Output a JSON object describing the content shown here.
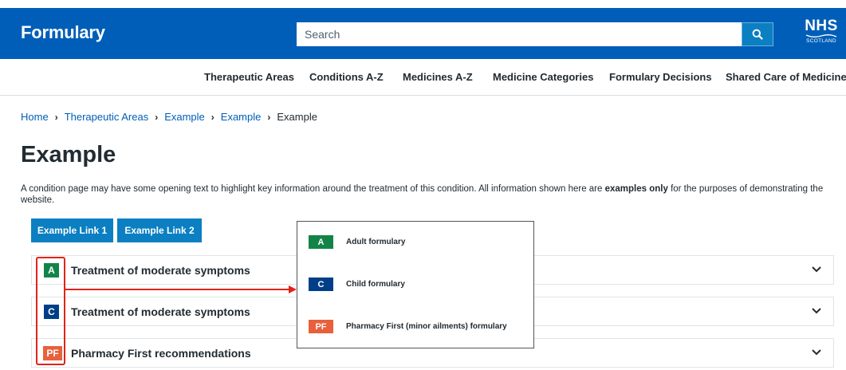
{
  "header": {
    "brand": "Formulary",
    "search_placeholder": "Search",
    "logo": {
      "line1": "NHS",
      "line2": "SCOTLAND"
    }
  },
  "nav": {
    "items": [
      "Therapeutic Areas",
      "Conditions A-Z",
      "Medicines A-Z",
      "Medicine Categories",
      "Formulary Decisions",
      "Shared Care of Medicines"
    ]
  },
  "breadcrumb": {
    "links": [
      "Home",
      "Therapeutic Areas",
      "Example",
      "Example"
    ],
    "current": "Example",
    "separator": "›"
  },
  "page": {
    "title": "Example",
    "intro_part1": "A condition page may have some opening text to highlight key information around the treatment of this condition.  All information shown here are ",
    "intro_bold": "examples only",
    "intro_part2": " for the purposes of demonstrating the website."
  },
  "buttons": [
    "Example Link 1",
    "Example Link 2"
  ],
  "accordion": [
    {
      "badge": "A",
      "badge_color": "#138447",
      "label": "Treatment of moderate symptoms"
    },
    {
      "badge": "C",
      "badge_color": "#003f87",
      "label": "Treatment of moderate symptoms"
    },
    {
      "badge": "PF",
      "badge_color": "#e8603c",
      "label": "Pharmacy First recommendations"
    }
  ],
  "legend": [
    {
      "badge": "A",
      "badge_color": "#138447",
      "text": "Adult formulary"
    },
    {
      "badge": "C",
      "badge_color": "#003f87",
      "text": "Child formulary"
    },
    {
      "badge": "PF",
      "badge_color": "#e8603c",
      "text": "Pharmacy First (minor ailments) formulary"
    }
  ],
  "colors": {
    "header_bg": "#005eb8",
    "button_bg": "#0b7fc2",
    "annotation_red": "#e2231a"
  },
  "icons": {
    "search": "search-icon",
    "chevron": "chevron-down-icon"
  }
}
